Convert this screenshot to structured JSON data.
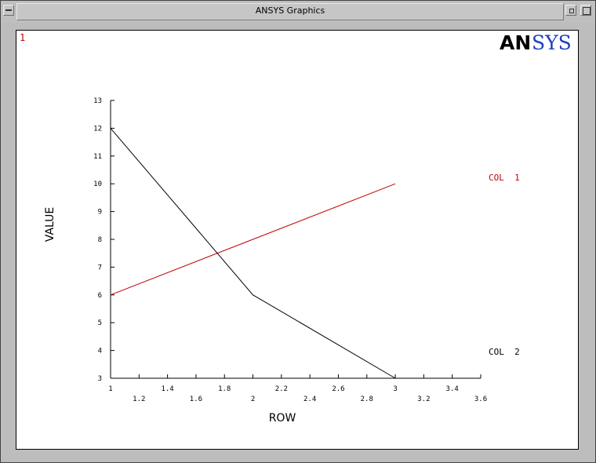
{
  "window": {
    "title": "ANSYS Graphics"
  },
  "plot": {
    "window_number": "1",
    "logo": {
      "text_an": "AN",
      "text_sys": "SYS",
      "color_an": "#000000",
      "color_sys": "#1f3fbf"
    }
  },
  "chart_data": {
    "type": "line",
    "xlabel": "ROW",
    "ylabel": "VALUE",
    "xlim": [
      1,
      3.6
    ],
    "ylim": [
      3,
      13
    ],
    "xticks": [
      1,
      1.2,
      1.4,
      1.6,
      1.8,
      2,
      2.2,
      2.4,
      2.6,
      2.8,
      3,
      3.2,
      3.4,
      3.6
    ],
    "xtick_labels": [
      "1",
      "1.2",
      "1.4",
      "1.6",
      "1.8",
      "2",
      "2.2",
      "2.4",
      "2.6",
      "2.8",
      "3",
      "3.2",
      "3.4",
      "3.6"
    ],
    "yticks": [
      3,
      4,
      5,
      6,
      7,
      8,
      9,
      10,
      11,
      12,
      13
    ],
    "ytick_labels": [
      "3",
      "4",
      "5",
      "6",
      "7",
      "8",
      "9",
      "10",
      "11",
      "12",
      "13"
    ],
    "series": [
      {
        "name": "COL  1",
        "color": "#c00000",
        "x": [
          1,
          2,
          3
        ],
        "values": [
          6,
          8,
          10
        ]
      },
      {
        "name": "COL  2",
        "color": "#000000",
        "x": [
          1,
          2,
          3
        ],
        "values": [
          12,
          6,
          3
        ]
      }
    ]
  }
}
